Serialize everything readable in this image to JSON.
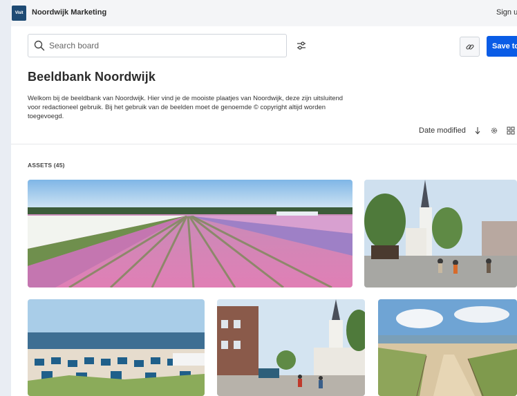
{
  "header": {
    "org_name": "Noordwijk Marketing",
    "logo_text": "Visit",
    "signup": "Sign up"
  },
  "search": {
    "placeholder": "Search board",
    "value": ""
  },
  "toolbar": {
    "save_label": "Save to..."
  },
  "board": {
    "title": "Beeldbank Noordwijk",
    "description": "Welkom bij de beeldbank van Noordwijk. Hier vind je de mooiste plaatjes van Noordwijk, deze zijn uitsluitend voor redactioneel gebruik. Bij het gebruik van de beelden moet de genoemde © copyright altijd worden toegevoegd."
  },
  "sort": {
    "label": "Date modified"
  },
  "assets": {
    "heading": "ASSETS (45)",
    "items": [
      {
        "subject": "bulb-fields"
      },
      {
        "subject": "church-square"
      },
      {
        "subject": "beach-chairs"
      },
      {
        "subject": "shopping-street"
      },
      {
        "subject": "dune-path"
      }
    ]
  },
  "colors": {
    "accent": "#0a5ce6",
    "logo": "#1f4b74",
    "topbar": "#f4f5f7"
  }
}
